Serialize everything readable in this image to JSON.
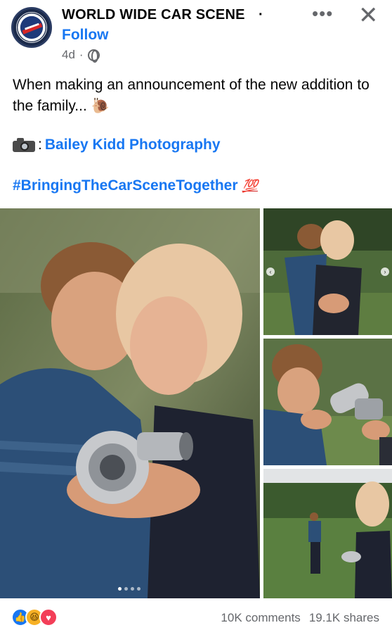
{
  "post": {
    "page_name": "WORLD WIDE CAR SCENE",
    "separator": "·",
    "follow_label": "Follow",
    "age": "4d",
    "age_separator": "·",
    "caption": "When making an announcement of the new addition to the family... 🐌",
    "credit_colon": ":",
    "credit_name": "Bailey Kidd Photography",
    "hashtag": "#BringingTheCarSceneTogether",
    "hundred_emoji": "💯"
  },
  "header_actions": {
    "more_icon": "more-horizontal-icon",
    "more_glyph": "•••",
    "close_icon": "close-icon",
    "close_glyph": "✕"
  },
  "photos": [
    {
      "name": "main",
      "description_icon": "photo"
    },
    {
      "name": "right-1",
      "description_icon": "photo"
    },
    {
      "name": "right-2",
      "description_icon": "photo"
    },
    {
      "name": "right-3",
      "description_icon": "photo"
    }
  ],
  "footer": {
    "reactions": [
      "like",
      "haha",
      "love"
    ],
    "comments": "10K comments",
    "shares": "19.1K shares"
  },
  "colors": {
    "link_blue": "#1877f2",
    "meta_gray": "#65676b"
  }
}
